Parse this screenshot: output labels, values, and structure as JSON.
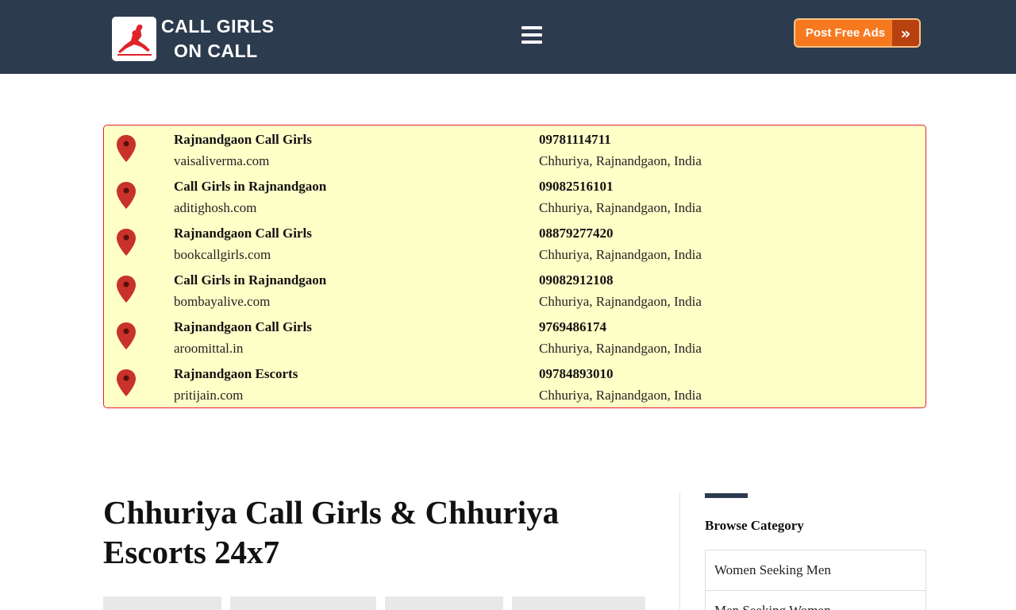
{
  "header": {
    "logo_line1": "CALL GIRLS",
    "logo_line2": "ON CALL",
    "post_ads_label": "Post Free Ads",
    "brand_color": "#2d3b4e",
    "accent_color": "#f7791f"
  },
  "listings": [
    {
      "title": "Rajnandgaon Call Girls",
      "site": "vaisaliverma.com",
      "phone": "09781114711",
      "location": "Chhuriya, Rajnandgaon, India"
    },
    {
      "title": "Call Girls in Rajnandgaon",
      "site": "aditighosh.com",
      "phone": "09082516101",
      "location": "Chhuriya, Rajnandgaon, India"
    },
    {
      "title": "Rajnandgaon Call Girls",
      "site": "bookcallgirls.com",
      "phone": "08879277420",
      "location": "Chhuriya, Rajnandgaon, India"
    },
    {
      "title": "Call Girls in Rajnandgaon",
      "site": "bombayalive.com",
      "phone": "09082912108",
      "location": "Chhuriya, Rajnandgaon, India"
    },
    {
      "title": "Rajnandgaon Call Girls",
      "site": "aroomittal.in",
      "phone": "9769486174",
      "location": "Chhuriya, Rajnandgaon, India"
    },
    {
      "title": "Rajnandgaon Escorts",
      "site": "pritijain.com",
      "phone": "09784893010",
      "location": "Chhuriya, Rajnandgaon, India"
    }
  ],
  "main": {
    "title": "Chhuriya Call Girls & Chhuriya Escorts 24x7"
  },
  "sidebar": {
    "heading": "Browse Category",
    "categories": [
      "Women Seeking Men",
      "Men Seeking Women"
    ]
  }
}
